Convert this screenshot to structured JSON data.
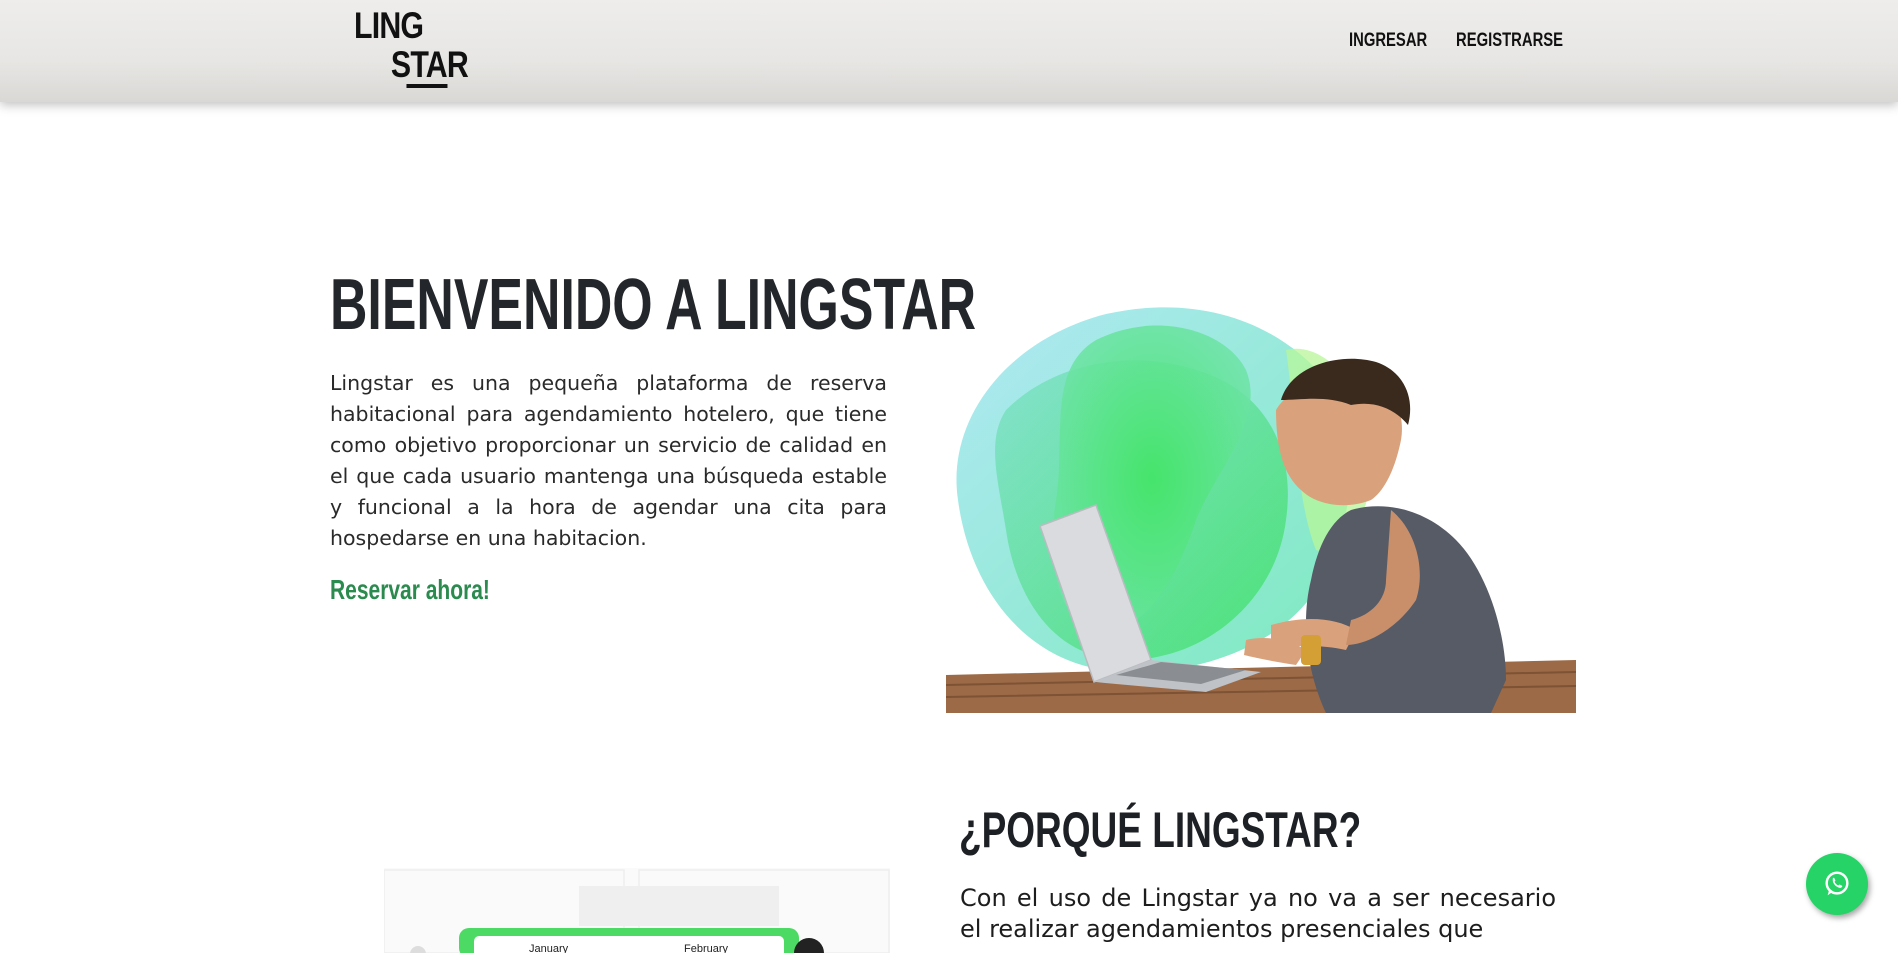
{
  "header": {
    "logo_line1": "LING",
    "logo_line2": "STAR",
    "nav": [
      {
        "label": "INGRESAR"
      },
      {
        "label": "REGISTRARSE"
      }
    ]
  },
  "hero": {
    "title": "BIENVENIDO A LINGSTAR",
    "description": "Lingstar es una pequeña plataforma de reserva habitacional para agendamiento hotelero, que tiene como objetivo proporcionar un servicio de calidad en el que cada usuario mantenga una búsqueda estable y funcional a la hora de agendar una cita para hospedarse en una habitacion.",
    "cta_label": "Reservar ahora!"
  },
  "why": {
    "title": "¿PORQUÉ LINGSTAR?",
    "text": "Con el uso de Lingstar ya no va a ser necesario el realizar agendamientos presenciales que"
  },
  "calendar_preview": {
    "month1": "January",
    "month2": "February"
  },
  "colors": {
    "accent_green": "#2b8a4e",
    "whatsapp_green": "#25d366",
    "title_dark": "#23262b"
  },
  "icons": {
    "floating_button": "whatsapp-icon"
  }
}
